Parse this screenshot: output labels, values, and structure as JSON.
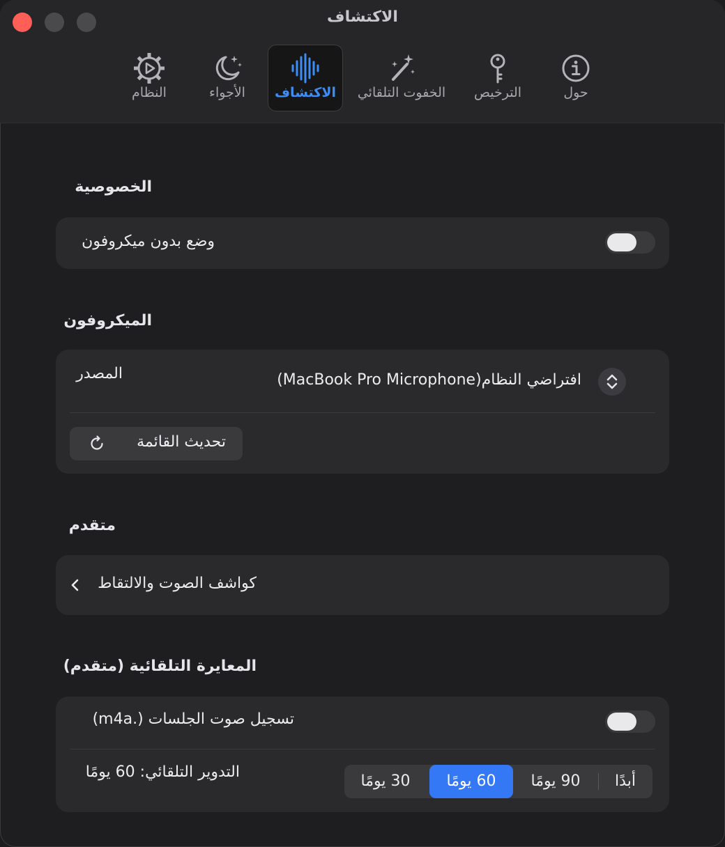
{
  "window": {
    "title": "الاكتشاف"
  },
  "tabs": [
    {
      "label": "حول",
      "icon": "info-icon"
    },
    {
      "label": "الترخيص",
      "icon": "key-icon"
    },
    {
      "label": "الخفوت التلقائي",
      "icon": "magic-wand-icon"
    },
    {
      "label": "الاكتشاف",
      "icon": "waveform-icon",
      "active": true
    },
    {
      "label": "الأجواء",
      "icon": "moon-stars-icon"
    },
    {
      "label": "النظام",
      "icon": "gear-play-icon"
    }
  ],
  "privacy": {
    "title": "الخصوصية",
    "no_mic_mode_label": "وضع بدون ميكروفون",
    "no_mic_mode_on": false
  },
  "microphone": {
    "title": "الميكروفون",
    "source_label": "المصدر",
    "source_value": "افتراضي النظام(MacBook Pro Microphone)",
    "refresh_label": "تحديث القائمة"
  },
  "advanced": {
    "title": "متقدم",
    "detectors_label": "كواشف الصوت والالتقاط"
  },
  "calibration": {
    "title": "المعايرة التلقائية (متقدم)",
    "record_label": "تسجيل صوت الجلسات (.m4a)",
    "record_on": false,
    "rotation_label": "التدوير التلقائي: 60 يومًا",
    "rotation_options": [
      "أبدًا",
      "90 يومًا",
      "60 يومًا",
      "30 يومًا"
    ],
    "rotation_selected": "60 يومًا"
  },
  "colors": {
    "accent": "#3478f6",
    "active_tab_text": "#3d8df5",
    "close": "#ff5f57",
    "card": "#2a2a2c",
    "background": "#1e1e20"
  }
}
